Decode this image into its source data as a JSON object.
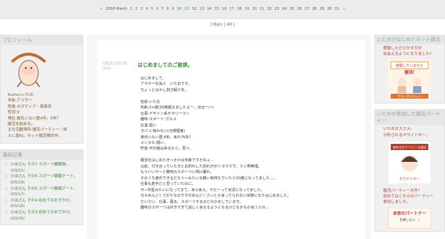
{
  "calendar": {
    "prev_arrow": "«",
    "month_label": "2018 March",
    "days": [
      "1",
      "2",
      "3",
      "4",
      "5",
      "6",
      "7",
      "8",
      "9",
      "10",
      "11",
      "12",
      "13",
      "14",
      "15",
      "16",
      "17",
      "18",
      "19",
      "20",
      "21",
      "22",
      "23",
      "24",
      "25",
      "26",
      "27",
      "28",
      "29",
      "30",
      "31"
    ],
    "linked_days": [
      "3",
      "4",
      "5",
      "6",
      "7",
      "8",
      "9",
      "10",
      "11",
      "13",
      "15",
      "16",
      "17",
      "19",
      "20",
      "21"
    ],
    "next_arrow": "»"
  },
  "nav": {
    "sep1": "|",
    "main": "Main",
    "sep2": "|",
    "all": "All",
    "sep3": "|"
  },
  "profile": {
    "title": "プロフィール",
    "lines": [
      "Author:いたお",
      "年齢:アラサー",
      "性格:ネガティブ・真面目",
      "性別:♀",
      "現在:彼氏いない歴4年。5年？",
      "  婚活を始める。",
      "主な活動場所:婚活パーティー・知",
      "人に皆似。ネット婚活検討中。"
    ]
  },
  "recent": {
    "title": "最新記事",
    "items": [
      "小出さん その7 スポーツ観戦後。(03/21)",
      "小出さん その6 スポーツ観戦デート。(03/19)",
      "小出さん その5 スポーツ観戦デート。(03/17)",
      "小出さん その4 初めてのおでかけ。(03/16)",
      "小出さん その3 初めてのおでかけ。(03/15)"
    ]
  },
  "post": {
    "date": "08/21/2016",
    "weekday": "Sun",
    "title": "はじめましてのご挨拶。",
    "body": [
      "はじめまして。",
      "アラサー社会人　いたおです。",
      "ちょっとばかし自己紹介を。",
      "",
      "名前:いたお",
      "年齢:3×歳(30歳超えましたよー。ほほーい)",
      "仕事:デザイン系サラリーマン",
      "趣味:スポーツ･グルメ",
      "お酒:弱い",
      "タバコ:吸わない(元喫煙者)",
      "彼氏いない歴:4年。あれ?5年?",
      "メンタル:弱い。",
      "貯金:平均値はあるかと。思う。",
      "",
      "婚活をはじめたきっかけは年齢ですかねぇ…",
      "以前、付き合っていた方とお別れした別れ方がトラウマで、マジ男無理。",
      "もういいや～と趣味のスポーツに明け暮れ。",
      "そのうち彼氏できるだろう～みたいな軽い気持ちでいたら30歳になってました…。",
      "仕事も若手だと思っていたのに、",
      "ザ☆中堅みたいになってきて。あらあら。やだーって状況になってました。",
      "元々めんどくさがりなのですがめんどくさいとか言ってられない状態になりはじめました。",
      "だいたい、仕事、寝る、スポーツするのどれかをしています。",
      "趣味のスポーツは好きすぎて話しく言えるようになるけどなかなか会う人の…"
    ]
  },
  "sidebar_ad1": {
    "title": "いたおがはじめたネット婚活",
    "text": [
      "登録しただけかすがが",
      "出会えるようになりました!"
    ],
    "banner_line1": "結婚しているなら",
    "banner_line2": "婚活!",
    "banner_brand": "ブライダルネット"
  },
  "sidebar_ad2": {
    "title": "いたおが参加した婚活パーティー",
    "text": [
      "いたおオススメ。",
      "分析されるホワイトキー。"
    ],
    "banner_caption": "条件付きパーティー＆婚活",
    "banner_line": "ホワイトキー",
    "text2": [
      "婚活パーティー大手！",
      "初めてはこちらのパーティー参加しました。"
    ],
    "banner2_line1": "本気のパートナー",
    "banner2_line2": "を探したい…!"
  },
  "colors": {
    "link": "#3a8a3a",
    "title": "#2a8a2a",
    "heading": "#8fa0b0",
    "accent_red": "#c0392b"
  }
}
